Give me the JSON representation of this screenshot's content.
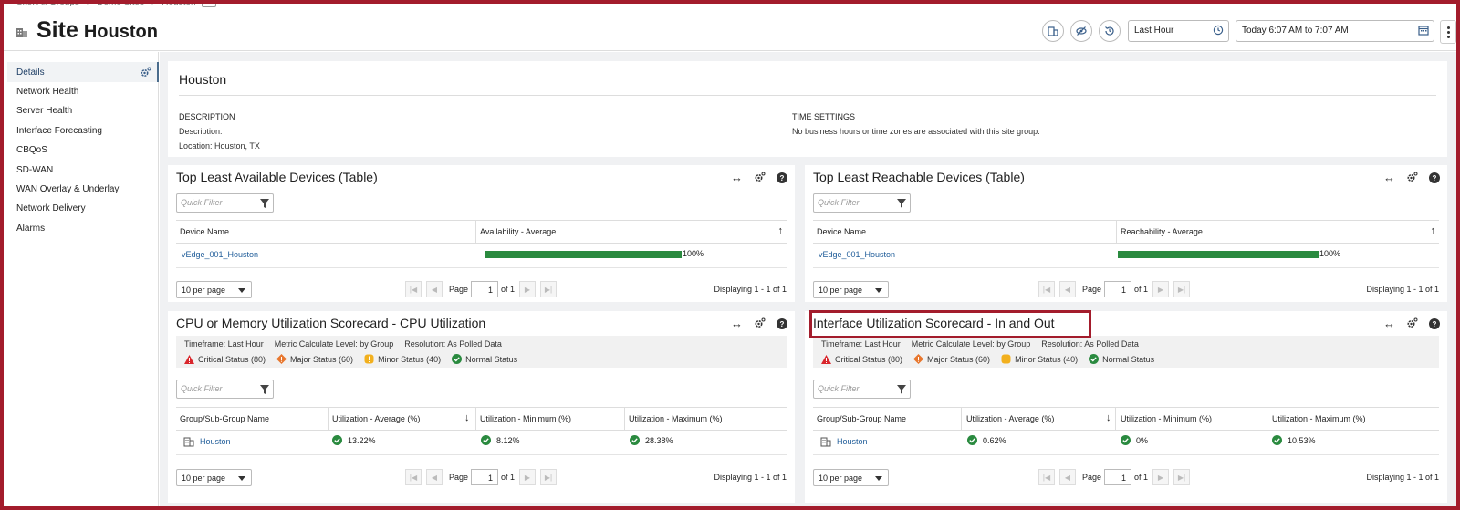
{
  "breadcrumb": {
    "items": [
      "Site: All Groups",
      "Demo Sites",
      "Houston"
    ]
  },
  "header": {
    "title": "Site",
    "site_name": "Houston",
    "time_range_select": "Last Hour",
    "time_window": "Today 6:07 AM to 7:07 AM",
    "icons": [
      "group-icon",
      "hide-icon",
      "history-icon",
      "clock-icon",
      "calendar-icon",
      "more-icon"
    ]
  },
  "sidebar": {
    "items": [
      {
        "label": "Details",
        "active": true
      },
      {
        "label": "Network Health"
      },
      {
        "label": "Server Health"
      },
      {
        "label": "Interface Forecasting"
      },
      {
        "label": "CBQoS"
      },
      {
        "label": "SD-WAN"
      },
      {
        "label": "WAN Overlay & Underlay"
      },
      {
        "label": "Network Delivery"
      },
      {
        "label": "Alarms"
      }
    ]
  },
  "info": {
    "title": "Houston",
    "description_heading": "DESCRIPTION",
    "description_label": "Description:",
    "location": "Location: Houston, TX",
    "time_settings_heading": "TIME SETTINGS",
    "time_settings_text": "No business hours or time zones are associated with this site group."
  },
  "common": {
    "quick_filter_placeholder": "Quick Filter",
    "per_page": "10 per page",
    "page_label": "Page",
    "page_value": "1",
    "page_of": "of 1",
    "displaying": "Displaying 1 - 1 of 1"
  },
  "availability_card": {
    "title": "Top Least Available Devices (Table)",
    "columns": [
      "Device Name",
      "Availability - Average"
    ],
    "rows": [
      {
        "device": "vEdge_001_Houston",
        "percent_label": "100%",
        "percent": 100
      }
    ]
  },
  "reachability_card": {
    "title": "Top Least Reachable Devices (Table)",
    "columns": [
      "Device Name",
      "Reachability - Average"
    ],
    "rows": [
      {
        "device": "vEdge_001_Houston",
        "percent_label": "100%",
        "percent": 100
      }
    ]
  },
  "scorecard_meta": {
    "timeframe": "Timeframe: Last Hour",
    "metric_level": "Metric Calculate Level: by Group",
    "resolution": "Resolution: As Polled Data",
    "statuses": [
      "Critical Status (80)",
      "Major Status (60)",
      "Minor Status (40)",
      "Normal Status"
    ],
    "status_colors": [
      "#d9262c",
      "#e8772e",
      "#f2b01e",
      "#2a8a3f"
    ]
  },
  "cpu_card": {
    "title": "CPU or Memory Utilization Scorecard - CPU Utilization",
    "columns": [
      "Group/Sub-Group Name",
      "Utilization - Average (%)",
      "Utilization - Minimum (%)",
      "Utilization - Maximum (%)"
    ],
    "row": {
      "group": "Houston",
      "avg": "13.22%",
      "min": "8.12%",
      "max": "28.38%"
    }
  },
  "interface_card": {
    "title": "Interface Utilization Scorecard - In and Out",
    "columns": [
      "Group/Sub-Group Name",
      "Utilization - Average (%)",
      "Utilization - Minimum (%)",
      "Utilization - Maximum (%)"
    ],
    "row": {
      "group": "Houston",
      "avg": "0.62%",
      "min": "0%",
      "max": "10.53%"
    }
  }
}
